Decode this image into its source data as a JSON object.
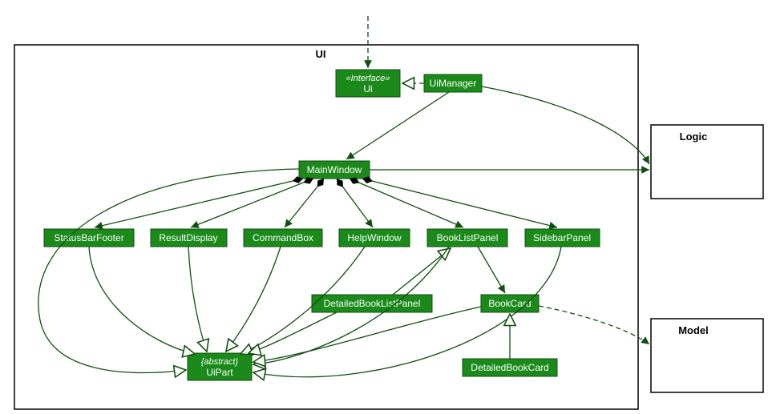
{
  "packages": {
    "ui": {
      "title": "UI"
    },
    "logic": {
      "title": "Logic"
    },
    "model": {
      "title": "Model"
    }
  },
  "classes": {
    "ui_iface": {
      "stereo": "«Interface»",
      "name": "Ui"
    },
    "uimanager": {
      "name": "UiManager"
    },
    "mainwindow": {
      "name": "MainWindow"
    },
    "statusbar": {
      "name": "StatusBarFooter"
    },
    "resultdisp": {
      "name": "ResultDisplay"
    },
    "cmdbox": {
      "name": "CommandBox"
    },
    "helpwin": {
      "name": "HelpWindow"
    },
    "booklist": {
      "name": "BookListPanel"
    },
    "sidebar": {
      "name": "SidebarPanel"
    },
    "detbooklist": {
      "name": "DetailedBookListPanel"
    },
    "bookcard": {
      "name": "BookCard"
    },
    "detbookcard": {
      "name": "DetailedBookCard"
    },
    "uipart": {
      "stereo": "{abstract}",
      "name": "UiPart"
    }
  }
}
